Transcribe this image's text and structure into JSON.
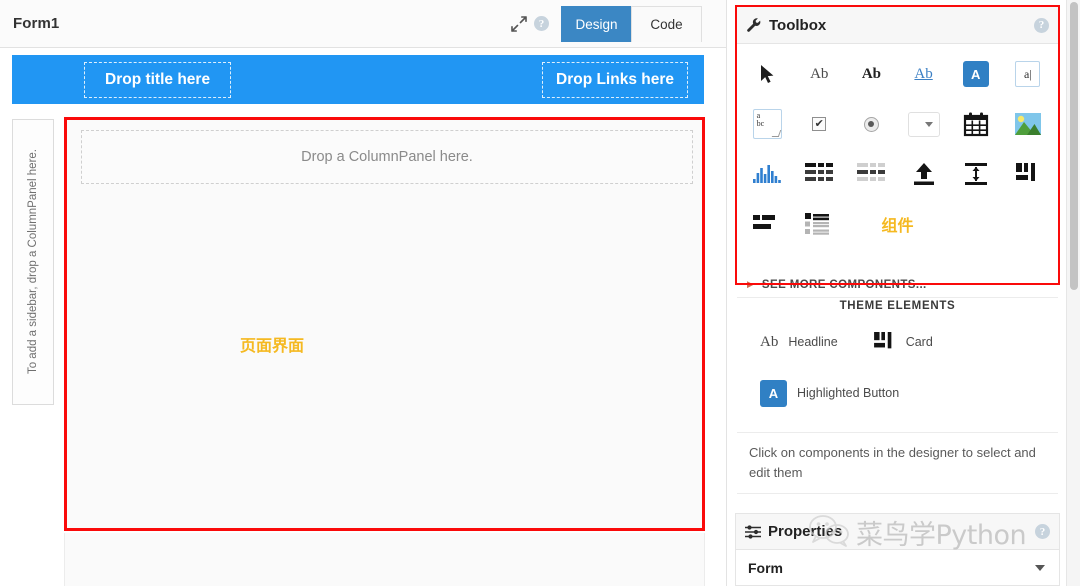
{
  "designer": {
    "form_title": "Form1",
    "icons": {
      "expand": "expand-arrows-icon",
      "help": "help-icon"
    },
    "tabs": [
      {
        "label": "Design",
        "active": true
      },
      {
        "label": "Code",
        "active": false
      }
    ],
    "banner": {
      "drop_title": "Drop title here",
      "drop_links": "Drop Links here",
      "color": "#2196f3"
    },
    "sidebar_drop_text": "To add a sidebar, drop a ColumnPanel here.",
    "canvas": {
      "column_panel_drop": "Drop a ColumnPanel here.",
      "annotation": "页面界面",
      "annotation_color": "#f5b921",
      "highlight_color": "#fa0a0a"
    }
  },
  "toolbox": {
    "title": "Toolbox",
    "wrench_icon": "wrench-icon",
    "help_icon": "help-icon",
    "annotation": "组件",
    "annotation_color": "#f5b921",
    "highlight_color": "#fa0a0a",
    "components": [
      {
        "name": "cursor-tool",
        "glyph": "➤",
        "selected": true
      },
      {
        "name": "label-component",
        "glyph": "Ab"
      },
      {
        "name": "bold-label-component",
        "glyph": "Ab"
      },
      {
        "name": "link-component",
        "glyph": "Ab"
      },
      {
        "name": "button-component",
        "glyph": "A"
      },
      {
        "name": "textbox-component",
        "glyph": "a|"
      },
      {
        "name": "textarea-component",
        "glyph": "a bc"
      },
      {
        "name": "checkbox-component",
        "glyph": "✔"
      },
      {
        "name": "radiobutton-component",
        "glyph": "◉"
      },
      {
        "name": "dropdown-component",
        "glyph": "▾"
      },
      {
        "name": "datepicker-component",
        "glyph": "calendar"
      },
      {
        "name": "image-component",
        "glyph": "image"
      },
      {
        "name": "plot-component",
        "glyph": "bars"
      },
      {
        "name": "datagrid-component",
        "glyph": "grid"
      },
      {
        "name": "repeatingpanel-component",
        "glyph": "grid-light"
      },
      {
        "name": "fileloader-component",
        "glyph": "⬆"
      },
      {
        "name": "spacer-component",
        "glyph": "spacer"
      },
      {
        "name": "card-component",
        "glyph": "card"
      },
      {
        "name": "linearpanel-component",
        "glyph": "lines"
      },
      {
        "name": "columnpanel-component",
        "glyph": "list"
      }
    ],
    "see_more": "SEE MORE COMPONENTS..."
  },
  "theme": {
    "title": "THEME ELEMENTS",
    "items": [
      {
        "label": "Headline",
        "icon": "ab-icon"
      },
      {
        "label": "Card",
        "icon": "card-icon"
      },
      {
        "label": "Highlighted Button",
        "icon": "blue-a-button-icon"
      }
    ]
  },
  "hint": {
    "text": "Click on components in the designer to select and edit them"
  },
  "properties": {
    "title": "Properties",
    "sliders_icon": "sliders-icon",
    "help_icon": "help-icon",
    "selected_object": "Form"
  },
  "watermark": {
    "text": "菜鸟学Python",
    "logo": "wechat-logo"
  }
}
